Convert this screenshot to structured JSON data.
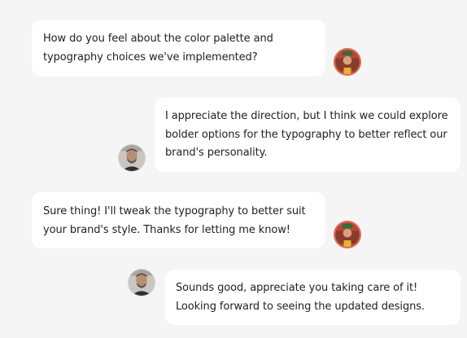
{
  "messages": [
    {
      "text": "How do you feel about the color palette and typography choices we've implemented?",
      "sender": "user-a"
    },
    {
      "text": "I appreciate the direction, but I think we could explore bolder options for the typography to better reflect our brand's personality.",
      "sender": "user-b"
    },
    {
      "text": "Sure thing! I'll tweak the typography to better suit your brand's style. Thanks for letting me know!",
      "sender": "user-a"
    },
    {
      "text": "Sounds good, appreciate you taking care of it! Looking forward to seeing the updated designs.",
      "sender": "user-b"
    }
  ],
  "colors": {
    "background": "#f5f5f5",
    "bubble": "#ffffff",
    "text": "#222222",
    "avatar_ring": "#e06b50"
  }
}
